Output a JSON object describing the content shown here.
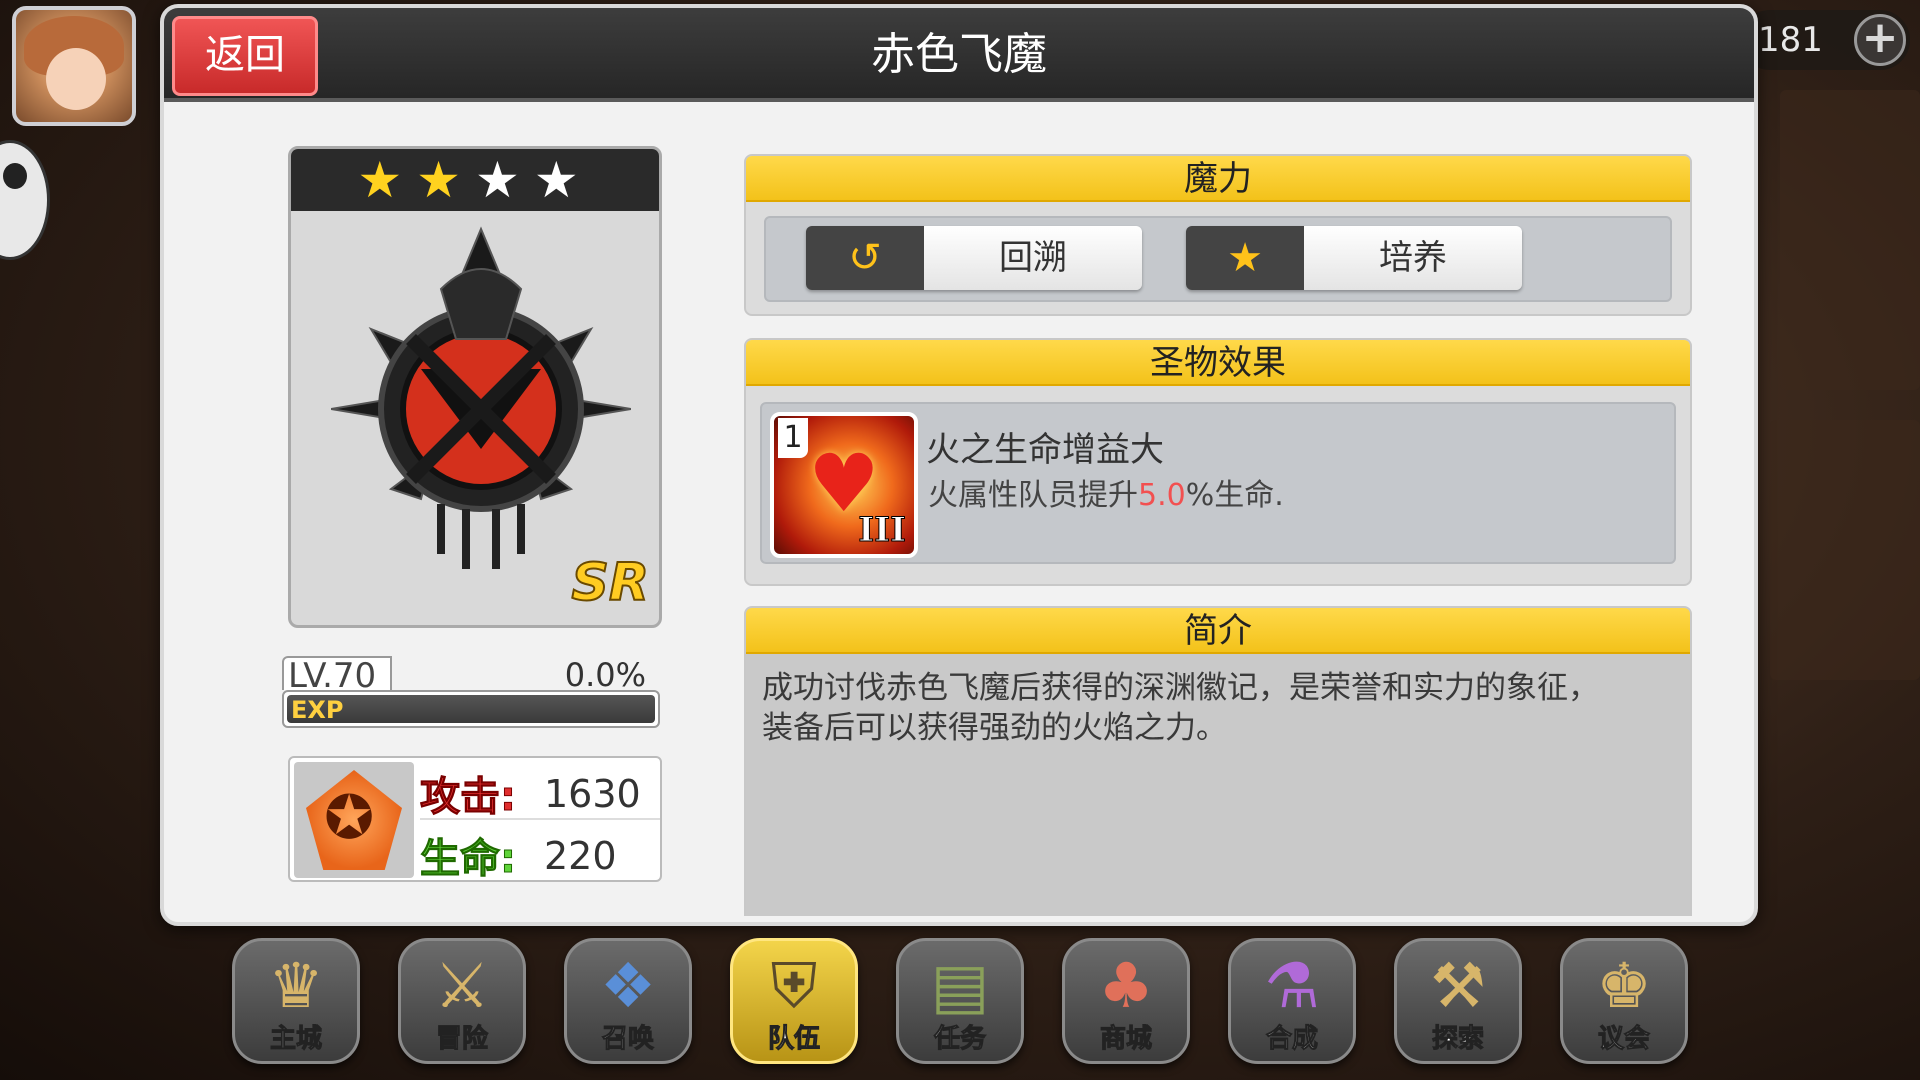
{
  "currency": {
    "amount": "181",
    "add_label": "+"
  },
  "header": {
    "back_label": "返回",
    "title": "赤色飞魔"
  },
  "relic": {
    "stars_gold": "★★",
    "stars_white": "★★",
    "rarity": "SR",
    "level": "LV.70",
    "exp_percent_label": "0.0%",
    "exp_fraction": 0.0,
    "exp_label": "EXP"
  },
  "stats": {
    "atk_label": "攻击:",
    "atk_value": "1630",
    "hp_label": "生命:",
    "hp_value": "220"
  },
  "magic": {
    "title": "魔力",
    "button1_label": "回溯",
    "button2_label": "培养"
  },
  "effect": {
    "title": "圣物效果",
    "slot_number": "1",
    "roman": "III",
    "name": "火之生命增益大",
    "desc_prefix": "火属性队员提升",
    "desc_value": "5.0",
    "desc_suffix": "%生命."
  },
  "intro": {
    "title": "简介",
    "text_line1": "成功讨伐赤色飞魔后获得的深渊徽记，是荣誉和实力的象征，",
    "text_line2": "装备后可以获得强劲的火焰之力。"
  },
  "nav": [
    {
      "label": "主城",
      "icon": "crown-icon"
    },
    {
      "label": "冒险",
      "icon": "crossed-swords-icon"
    },
    {
      "label": "召唤",
      "icon": "summon-card-icon"
    },
    {
      "label": "队伍",
      "icon": "winged-shield-icon"
    },
    {
      "label": "任务",
      "icon": "book-icon"
    },
    {
      "label": "商城",
      "icon": "shop-tree-icon"
    },
    {
      "label": "合成",
      "icon": "potion-icon"
    },
    {
      "label": "探索",
      "icon": "shovel-icon"
    },
    {
      "label": "议会",
      "icon": "council-crest-icon"
    }
  ],
  "colors": {
    "accent_yellow": "#f3c21a",
    "back_red": "#d63333",
    "highlight_red": "#f25050",
    "hp_green": "#5fd43a"
  }
}
